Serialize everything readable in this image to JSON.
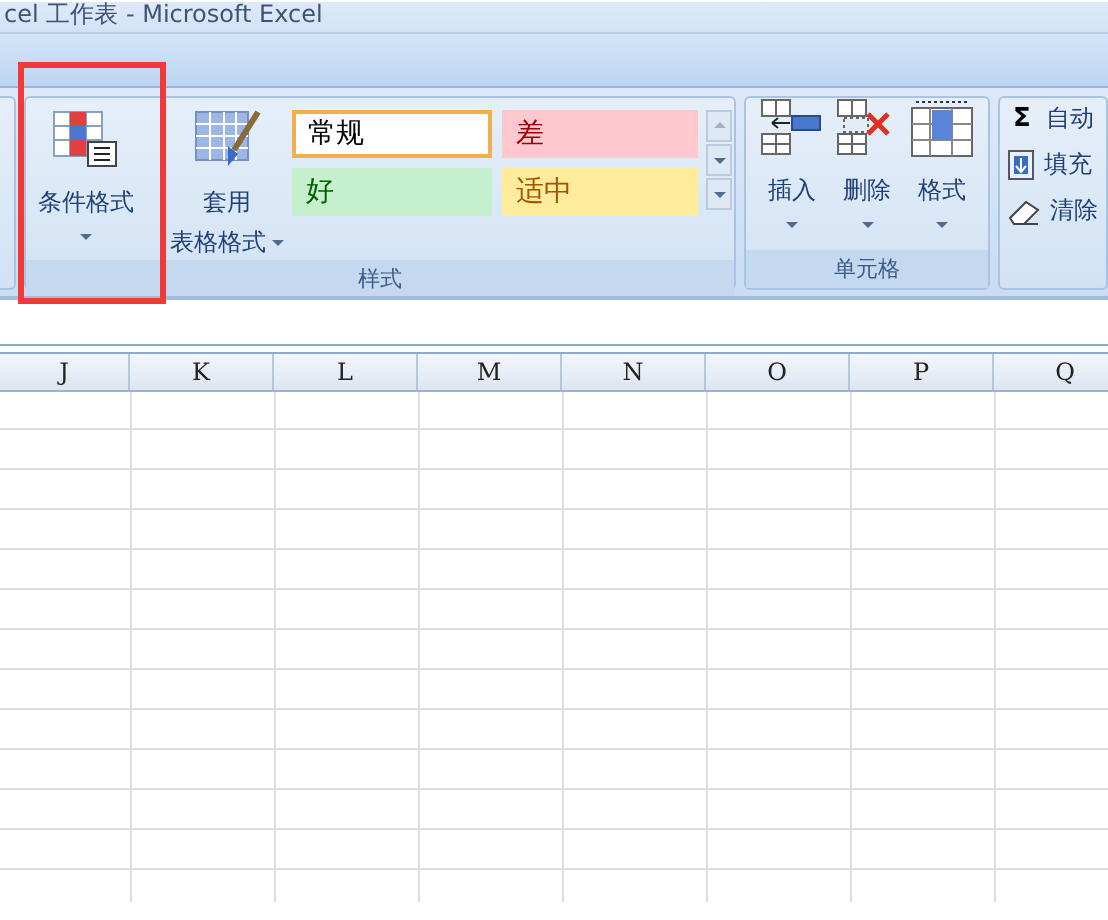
{
  "window": {
    "title": "cel 工作表 - Microsoft Excel"
  },
  "styles_group": {
    "label": "样式",
    "buttons": [
      {
        "kind": "conditional",
        "lines": [
          "条件格式"
        ]
      },
      {
        "kind": "table",
        "lines": [
          "套用",
          "表格格式"
        ]
      }
    ],
    "gallery": [
      {
        "label": "常规",
        "kind": "normal",
        "selected": true
      },
      {
        "label": "差",
        "kind": "bad",
        "selected": false
      },
      {
        "label": "好",
        "kind": "good",
        "selected": false
      },
      {
        "label": "适中",
        "kind": "neutral",
        "selected": false
      }
    ]
  },
  "cells_group": {
    "label": "单元格",
    "buttons": [
      {
        "kind": "insert",
        "label": "插入"
      },
      {
        "kind": "delete",
        "label": "删除"
      },
      {
        "kind": "format",
        "label": "格式"
      }
    ]
  },
  "editing_group": {
    "items": [
      {
        "kind": "sum",
        "icon": "Σ",
        "label": "自动"
      },
      {
        "kind": "fill",
        "label": "填充"
      },
      {
        "kind": "clear",
        "label": "清除"
      }
    ]
  },
  "sheet": {
    "columns": [
      "J",
      "K",
      "L",
      "M",
      "N",
      "O",
      "P",
      "Q"
    ]
  }
}
